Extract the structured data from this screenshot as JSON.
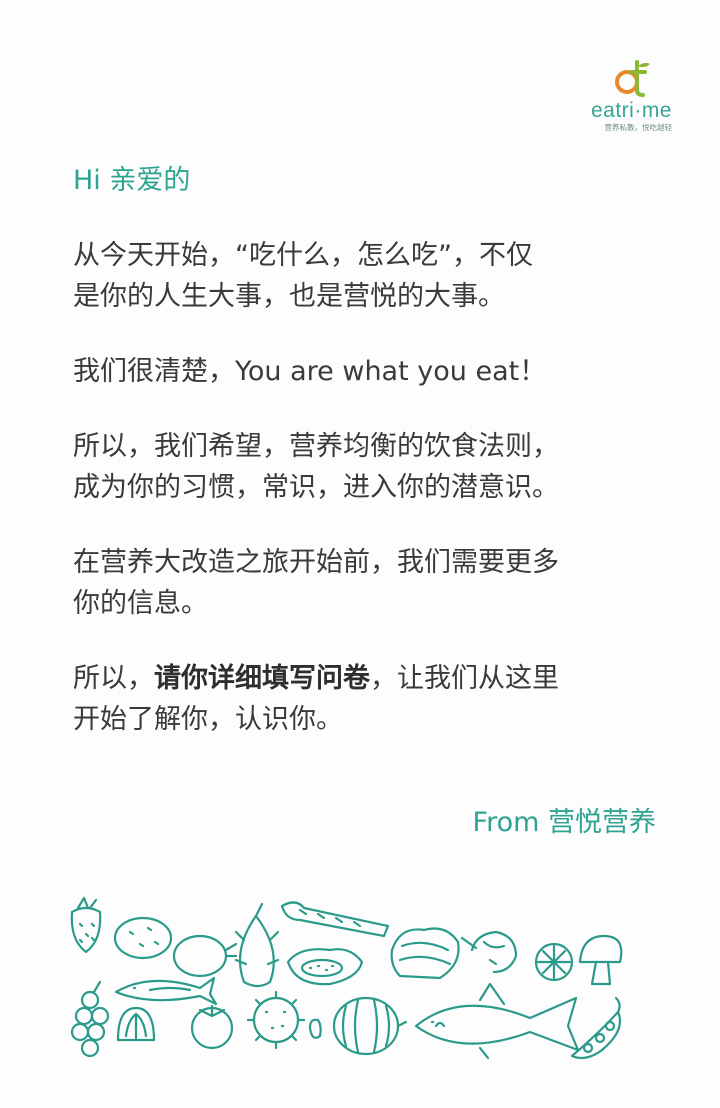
{
  "logo": {
    "wordmark": "eatri·me",
    "tagline": "营养私教，悦吃越轻"
  },
  "letter": {
    "greeting": "Hi 亲爱的",
    "p1": [
      "从今天开始，“吃什么，怎么吃”，不仅",
      "是你的人生大事，也是营悦的大事。"
    ],
    "p2": "我们很清楚，You are what you eat！",
    "p3": [
      "所以，我们希望，营养均衡的饮食法则，",
      "成为你的习惯，常识，进入你的潜意识。"
    ],
    "p4": [
      "在营养大改造之旅开始前，我们需要更多",
      "你的信息。"
    ],
    "p5": {
      "prefix": "所以，",
      "emphasis": "请你详细填写问卷",
      "suffix": "，让我们从这里",
      "line2": "开始了解你，认识你。"
    }
  },
  "signature": "From 营悦营养",
  "colors": {
    "accent": "#2fa392",
    "text": "#3a3a3a",
    "logo_orange": "#e9892a",
    "logo_green": "#8ab833"
  },
  "illustration": {
    "items": [
      "strawberry-icon",
      "potato-icon",
      "kiwi-icon",
      "dragon-fruit-icon",
      "asparagus-icon",
      "salmon-slices-icon",
      "shrimp-icon",
      "lime-icon",
      "mushroom-icon",
      "papaya-icon",
      "sardine-icon",
      "grapes-icon",
      "clam-icon",
      "persimmon-icon",
      "kiwano-icon",
      "peanut-icon",
      "watermelon-icon",
      "tuna-icon",
      "pea-pod-icon"
    ]
  }
}
